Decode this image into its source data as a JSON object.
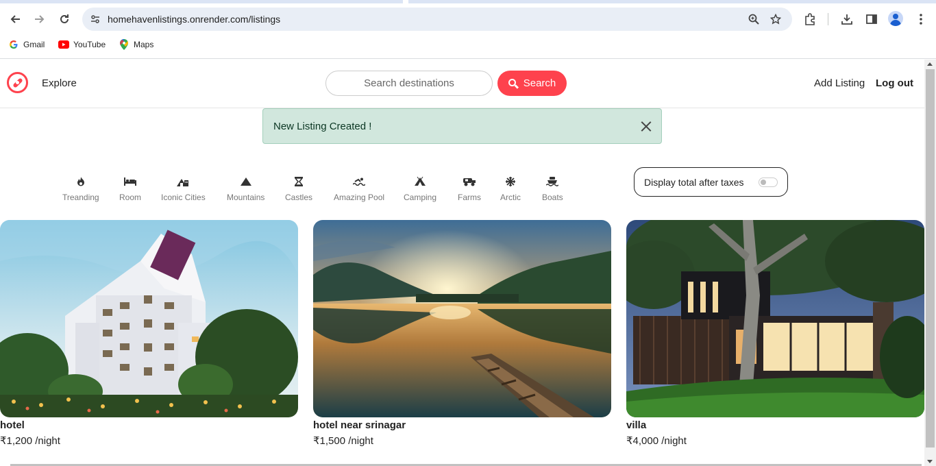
{
  "browser": {
    "url": "homehavenlistings.onrender.com/listings",
    "bookmarks": [
      {
        "label": "Gmail",
        "icon": "google-g-icon"
      },
      {
        "label": "YouTube",
        "icon": "youtube-icon"
      },
      {
        "label": "Maps",
        "icon": "maps-pin-icon"
      }
    ]
  },
  "navbar": {
    "explore": "Explore",
    "search_placeholder": "Search destinations",
    "search_button": "Search",
    "add_listing": "Add Listing",
    "logout": "Log out",
    "brand_color": "#fe424d"
  },
  "alert": {
    "message": "New Listing Created !"
  },
  "filters": [
    {
      "label": "Treanding",
      "icon": "fire-icon"
    },
    {
      "label": "Room",
      "icon": "bed-icon"
    },
    {
      "label": "Iconic Cities",
      "icon": "city-icon"
    },
    {
      "label": "Mountains",
      "icon": "mountain-icon"
    },
    {
      "label": "Castles",
      "icon": "castle-icon"
    },
    {
      "label": "Amazing Pool",
      "icon": "pool-icon"
    },
    {
      "label": "Camping",
      "icon": "tent-icon"
    },
    {
      "label": "Farms",
      "icon": "tractor-icon"
    },
    {
      "label": "Arctic",
      "icon": "snowflake-icon"
    },
    {
      "label": "Boats",
      "icon": "ship-icon"
    }
  ],
  "tax_toggle": {
    "label": "Display total after taxes",
    "enabled": false
  },
  "listings": [
    {
      "title": "hotel",
      "price": "₹1,200 /night"
    },
    {
      "title": "hotel near srinagar",
      "price": "₹1,500 /night"
    },
    {
      "title": "villa",
      "price": "₹4,000 /night"
    }
  ]
}
